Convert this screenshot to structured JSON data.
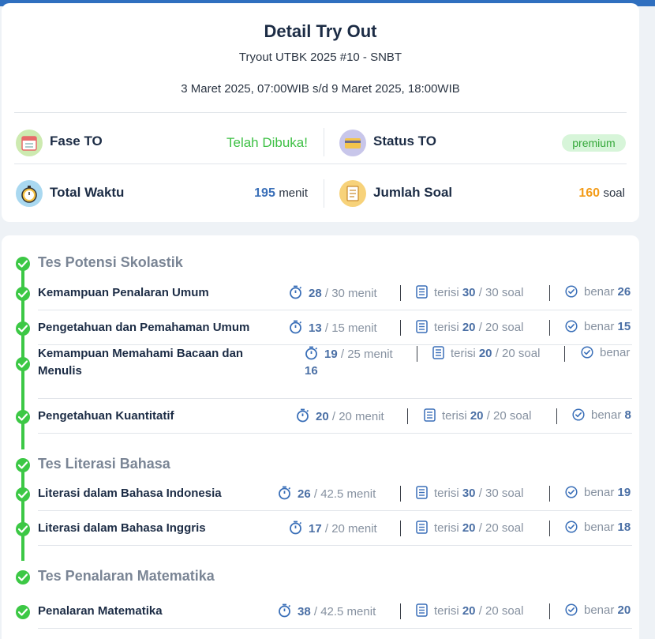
{
  "header": {
    "title": "Detail Try Out",
    "subtitle": "Tryout UTBK 2025 #10 - SNBT",
    "date_range": "3 Maret 2025, 07:00WIB s/d 9 Maret 2025, 18:00WIB"
  },
  "stats": {
    "fase": {
      "label": "Fase TO",
      "value": "Telah Dibuka!",
      "icon": "calendar-icon"
    },
    "status": {
      "label": "Status TO",
      "value": "premium",
      "icon": "card-icon"
    },
    "waktu": {
      "label": "Total Waktu",
      "value": "195",
      "unit": "menit",
      "icon": "stopwatch-icon"
    },
    "soal": {
      "label": "Jumlah Soal",
      "value": "160",
      "unit": "soal",
      "icon": "document-icon"
    }
  },
  "sections": [
    {
      "title": "Tes Potensi Skolastik",
      "rows": [
        {
          "name": "Kemampuan Penalaran Umum",
          "time_used": "28",
          "time_total": "/ 30 menit",
          "filled_prefix": "terisi",
          "filled": "30",
          "filled_total": "/ 30 soal",
          "correct_prefix": "benar",
          "correct": "26"
        },
        {
          "name": "Pengetahuan dan Pemahaman Umum",
          "time_used": "13",
          "time_total": "/ 15 menit",
          "filled_prefix": "terisi",
          "filled": "20",
          "filled_total": "/ 20 soal",
          "correct_prefix": "benar",
          "correct": "15"
        },
        {
          "name": "Kemampuan Memahami Bacaan dan Menulis",
          "time_used": "19",
          "time_total": "/ 25 menit",
          "filled_prefix": "terisi",
          "filled": "20",
          "filled_total": "/ 20 soal",
          "correct_prefix": "benar",
          "correct": "16"
        },
        {
          "name": "Pengetahuan Kuantitatif",
          "time_used": "20",
          "time_total": "/ 20 menit",
          "filled_prefix": "terisi",
          "filled": "20",
          "filled_total": "/ 20 soal",
          "correct_prefix": "benar",
          "correct": "8"
        }
      ]
    },
    {
      "title": "Tes Literasi Bahasa",
      "rows": [
        {
          "name": "Literasi dalam Bahasa Indonesia",
          "time_used": "26",
          "time_total": "/ 42.5 menit",
          "filled_prefix": "terisi",
          "filled": "30",
          "filled_total": "/ 30 soal",
          "correct_prefix": "benar",
          "correct": "19"
        },
        {
          "name": "Literasi dalam Bahasa Inggris",
          "time_used": "17",
          "time_total": "/ 20 menit",
          "filled_prefix": "terisi",
          "filled": "20",
          "filled_total": "/ 20 soal",
          "correct_prefix": "benar",
          "correct": "18"
        }
      ]
    },
    {
      "title": "Tes Penalaran Matematika",
      "rows": [
        {
          "name": "Penalaran Matematika",
          "time_used": "38",
          "time_total": "/ 42.5 menit",
          "filled_prefix": "terisi",
          "filled": "20",
          "filled_total": "/ 20 soal",
          "correct_prefix": "benar",
          "correct": "20"
        }
      ]
    }
  ],
  "colors": {
    "accent_green": "#3cc845",
    "accent_blue": "#3a6fb8",
    "accent_orange": "#f39c1a",
    "topbar": "#2f6fbf"
  }
}
